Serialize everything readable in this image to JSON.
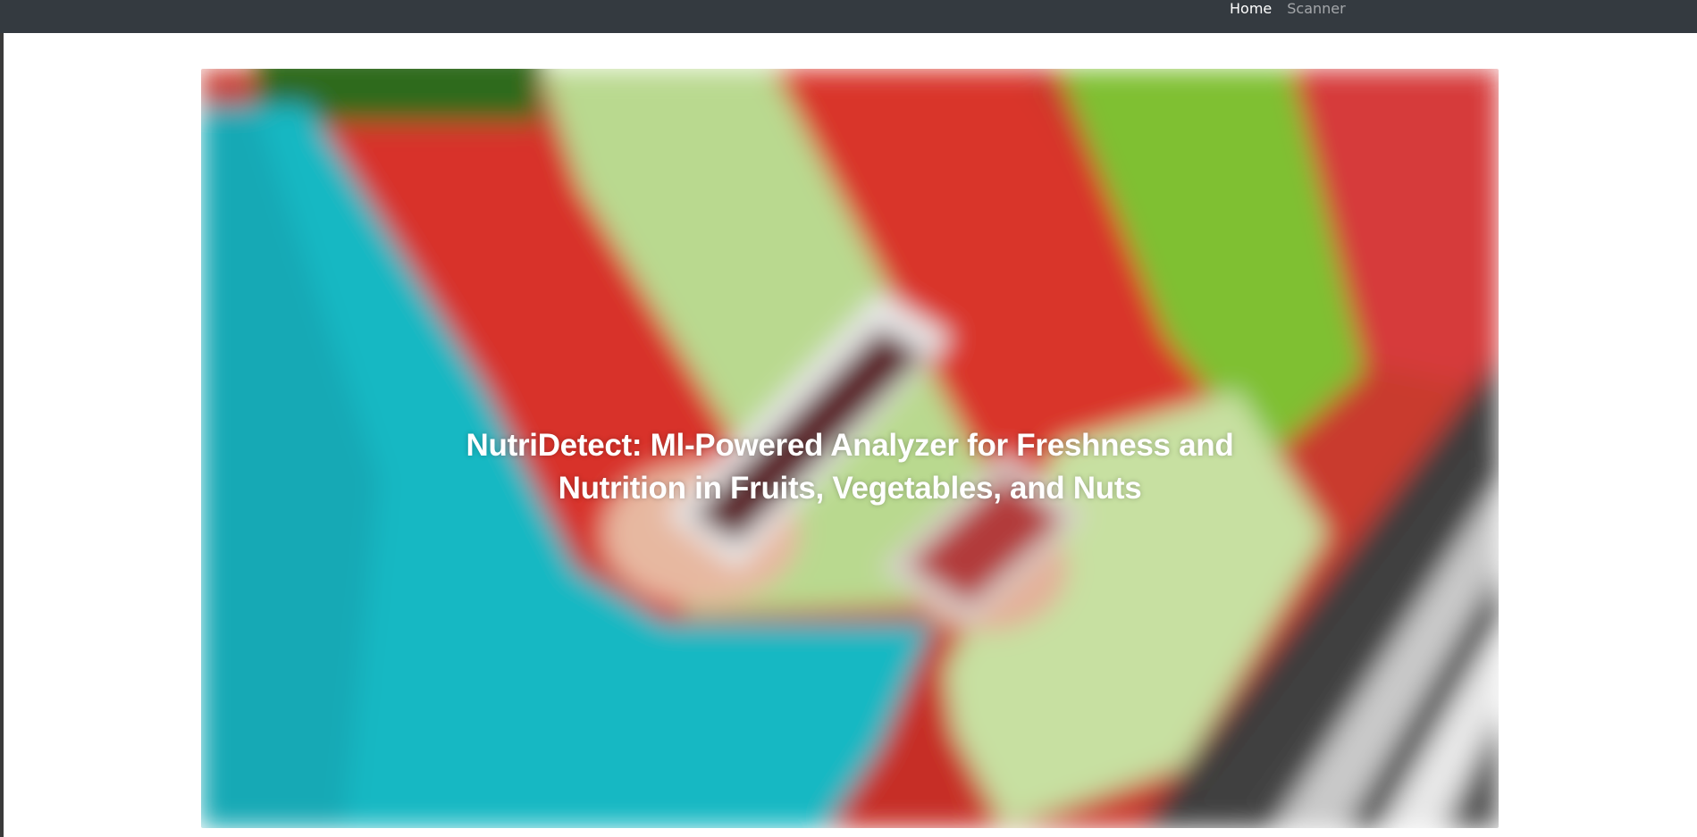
{
  "nav": {
    "items": [
      {
        "label": "Home",
        "active": true
      },
      {
        "label": "Scanner",
        "active": false
      }
    ],
    "background": "#343a40"
  },
  "hero": {
    "title_line1": "NutriDetect: Ml-Powered Analyzer for Freshness and",
    "title_line2": "Nutrition in Fruits, Vegetables, and Nuts",
    "image": "blurred-produce-shopper-photo"
  }
}
